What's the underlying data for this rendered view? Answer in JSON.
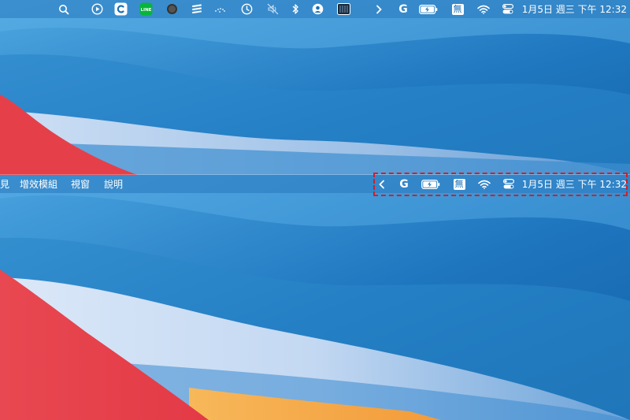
{
  "top_menubar": {
    "items": [
      "search-icon",
      "play-circle-icon",
      "app-c-icon",
      "line-icon",
      "record-icon",
      "stack-icon",
      "dots-icon",
      "clock-icon",
      "mute-icon",
      "bluetooth-icon",
      "user-circle-icon",
      "grid-icon",
      "chevron-right-icon",
      "google-icon",
      "battery-charging-icon",
      "ime-icon",
      "wifi-icon",
      "control-center-icon"
    ],
    "line_badge": "LINE",
    "ime_label": "無",
    "google_label": "G",
    "datetime": "1月5日 週三 下午 12:32"
  },
  "bottom_menubar": {
    "menu_items": [
      "見",
      "增效模組",
      "視窗",
      "說明"
    ],
    "ime_label": "無",
    "google_label": "G",
    "datetime": "1月5日 週三 下午 12:32"
  },
  "colors": {
    "highlight_border": "#d21f26",
    "wallpaper_blue": "#1a6fb5",
    "wallpaper_red": "#e5404a",
    "line_green": "#07b53b"
  }
}
